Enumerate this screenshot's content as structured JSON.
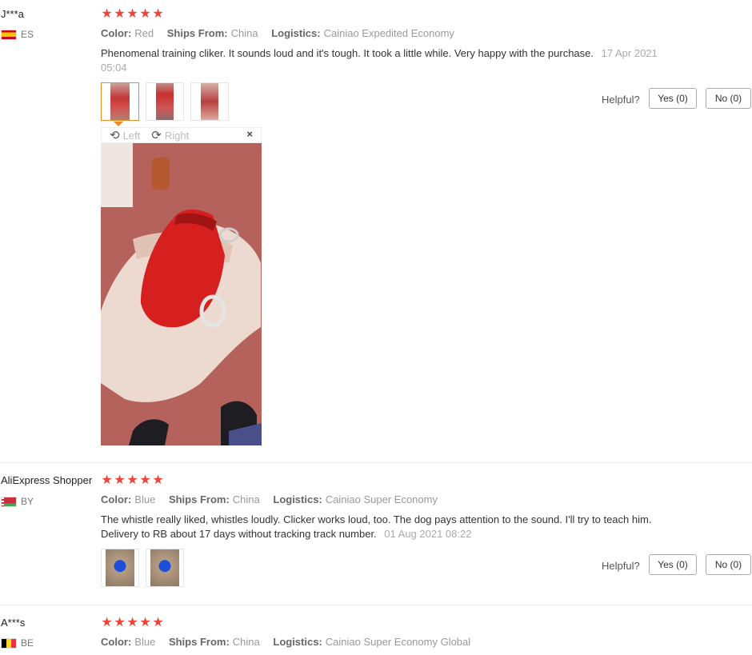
{
  "labels": {
    "color": "Color:",
    "ships_from": "Ships From:",
    "logistics": "Logistics:",
    "helpful": "Helpful?"
  },
  "viewer": {
    "rotate_left": "Left",
    "rotate_right": "Right",
    "close": "×"
  },
  "reviews": [
    {
      "user": "J***a",
      "country": "ES",
      "rating": 5,
      "color": "Red",
      "ships_from": "China",
      "logistics": "Cainiao Expedited Economy",
      "text": "Phenomenal training cliker. It sounds loud and it's tough. It took a little while. Very happy with the purchase.",
      "date": "17 Apr 2021 05:04",
      "yes": "Yes (0)",
      "no": "No (0)"
    },
    {
      "user": "AliExpress Shopper",
      "country": "BY",
      "rating": 5,
      "color": "Blue",
      "ships_from": "China",
      "logistics": "Cainiao Super Economy",
      "text": "The whistle really liked, whistles loudly. Clicker works loud, too. The dog pays attention to the sound. I'll try to teach him. Delivery to RB about 17 days without tracking track number.",
      "date": "01 Aug 2021 08:22",
      "yes": "Yes (0)",
      "no": "No (0)"
    },
    {
      "user": "A***s",
      "country": "BE",
      "rating": 5,
      "color": "Blue",
      "ships_from": "China",
      "logistics": "Cainiao Super Economy Global"
    }
  ]
}
